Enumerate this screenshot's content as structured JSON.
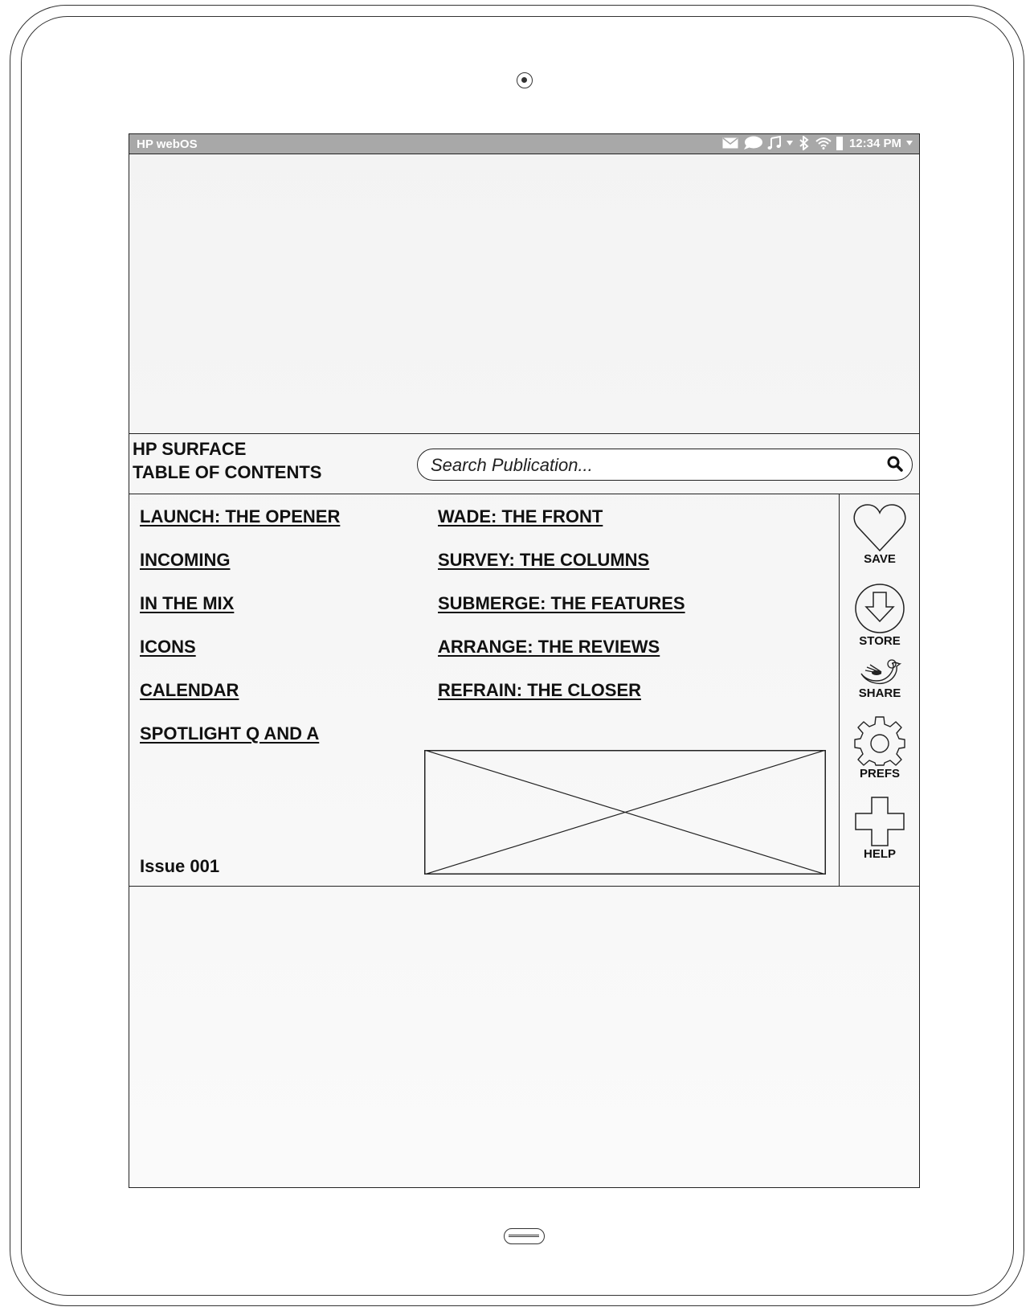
{
  "status_bar": {
    "os_name": "HP webOS",
    "time": "12:34 PM",
    "icons": [
      "mail-icon",
      "chat-icon",
      "music-icon",
      "bluetooth-icon",
      "wifi-icon",
      "battery-icon"
    ]
  },
  "header": {
    "title_line1": "HP SURFACE",
    "title_line2": "TABLE OF CONTENTS",
    "search_placeholder": "Search Publication..."
  },
  "toc": {
    "left": [
      "LAUNCH: THE OPENER",
      "INCOMING",
      "IN THE MIX",
      "ICONS",
      "CALENDAR",
      "SPOTLIGHT Q AND A"
    ],
    "right": [
      "WADE: THE FRONT",
      "SURVEY: THE COLUMNS",
      "SUBMERGE: THE FEATURES",
      "ARRANGE: THE REVIEWS",
      "REFRAIN: THE CLOSER"
    ]
  },
  "issue_label": "Issue 001",
  "sidebar": {
    "save": "SAVE",
    "store": "STORE",
    "share": "SHARE",
    "prefs": "PREFS",
    "help": "HELP"
  }
}
